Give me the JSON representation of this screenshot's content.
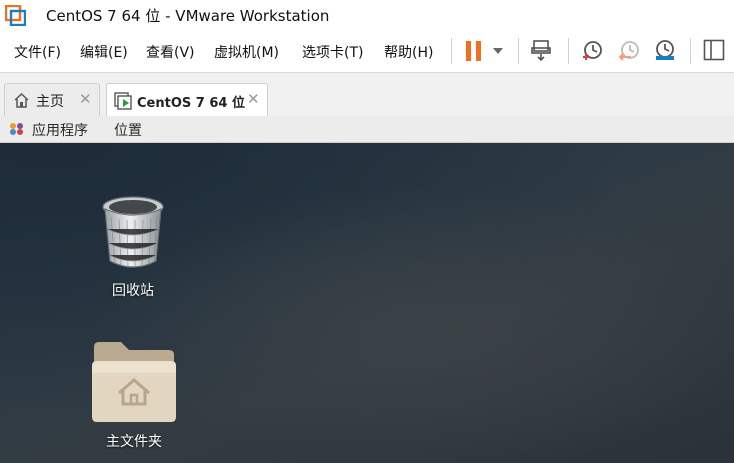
{
  "window": {
    "title": "CentOS 7 64 位 - VMware Workstation"
  },
  "menu": [
    {
      "label": "文件(F)"
    },
    {
      "label": "编辑(E)"
    },
    {
      "label": "查看(V)"
    },
    {
      "label": "虚拟机(M)"
    },
    {
      "label": "选项卡(T)"
    },
    {
      "label": "帮助(H)"
    }
  ],
  "toolbar": {
    "icons": [
      "pause-icon",
      "dropdown-arrow-icon",
      "send-ctrl-alt-del-icon",
      "snapshot-take-icon",
      "snapshot-revert-icon",
      "snapshot-manager-icon",
      "sidebar-toggle-icon"
    ],
    "accent": "#f07020"
  },
  "tabs": [
    {
      "label": "主页",
      "icon": "home-icon",
      "active": false
    },
    {
      "label": "CentOS 7 64 位",
      "icon": "vm-running-icon",
      "active": true
    }
  ],
  "guest_topbar": {
    "applications": "应用程序",
    "places": "位置"
  },
  "desktop_icons": [
    {
      "label": "回收站",
      "icon": "trash-icon"
    },
    {
      "label": "主文件夹",
      "icon": "home-folder-icon"
    }
  ]
}
